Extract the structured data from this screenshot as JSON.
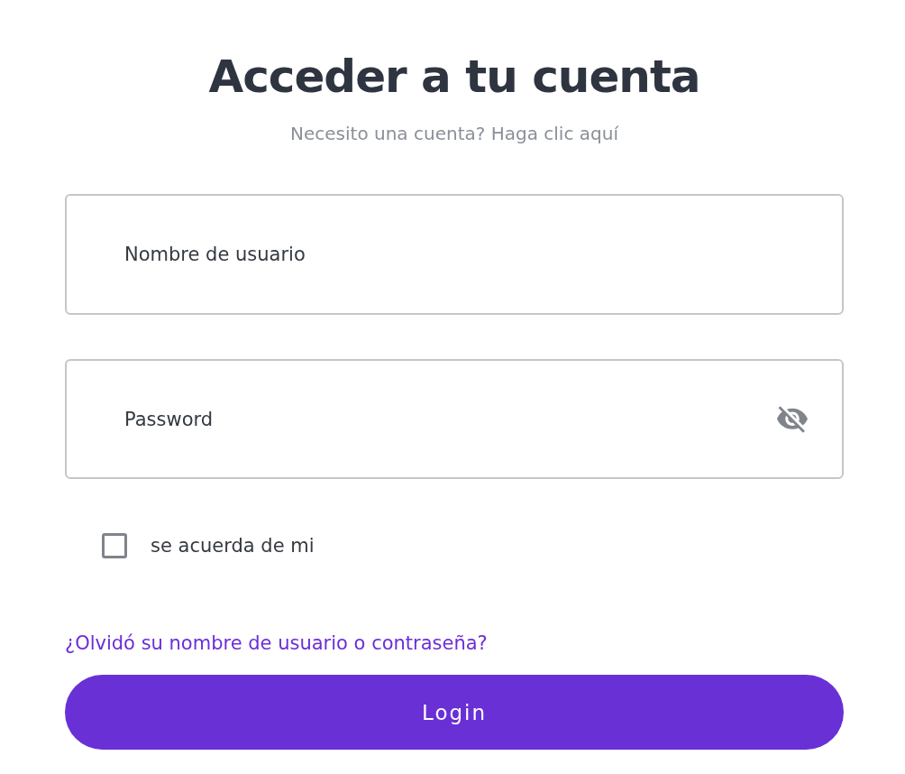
{
  "title": "Acceder a tu cuenta",
  "subtitle": "Necesito una cuenta? Haga clic aquí",
  "fields": [
    {
      "kind": "text",
      "placeholder": "Nombre de usuario"
    },
    {
      "kind": "password",
      "placeholder": "Password"
    }
  ],
  "remember": {
    "label": "se acuerda de mi",
    "checked": false
  },
  "forgot_link": "¿Olvidó su nombre de usuario o contraseña?",
  "login_button": "Login"
}
